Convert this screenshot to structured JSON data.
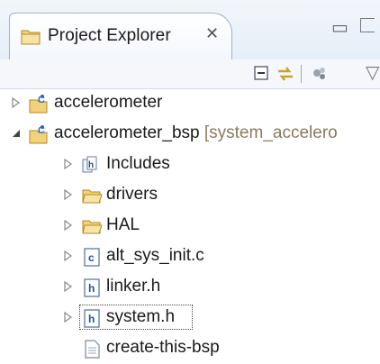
{
  "view": {
    "title": "Project Explorer",
    "close_glyph": "✕",
    "minimize_glyph": "▭",
    "toolbar": {
      "icons": [
        "collapse-all-icon",
        "link-with-editor-icon",
        "filters-icon"
      ],
      "more_glyph": "▽"
    }
  },
  "tree": [
    {
      "label": "accelerometer",
      "suffix": "",
      "icon": "project-c-icon",
      "expanded": false
    },
    {
      "label": "accelerometer_bsp",
      "suffix": " [system_accelero",
      "icon": "project-c-icon",
      "expanded": true
    },
    {
      "label": "Includes",
      "suffix": "",
      "icon": "includes-icon",
      "expanded": false
    },
    {
      "label": "drivers",
      "suffix": "",
      "icon": "folder-icon",
      "expanded": false
    },
    {
      "label": "HAL",
      "suffix": "",
      "icon": "folder-icon",
      "expanded": false
    },
    {
      "label": "alt_sys_init.c",
      "suffix": "",
      "icon": "c-file-icon",
      "expanded": false
    },
    {
      "label": "linker.h",
      "suffix": "",
      "icon": "h-file-icon",
      "expanded": false
    },
    {
      "label": "system.h",
      "suffix": "",
      "icon": "h-file-icon",
      "expanded": false,
      "selected": true
    },
    {
      "label": "create-this-bsp",
      "suffix": "",
      "icon": "file-icon",
      "expanded": false
    }
  ],
  "colors": {
    "folder": "#e8c04a",
    "project_c": "#3a7fd5",
    "selection_border": "#444444"
  }
}
